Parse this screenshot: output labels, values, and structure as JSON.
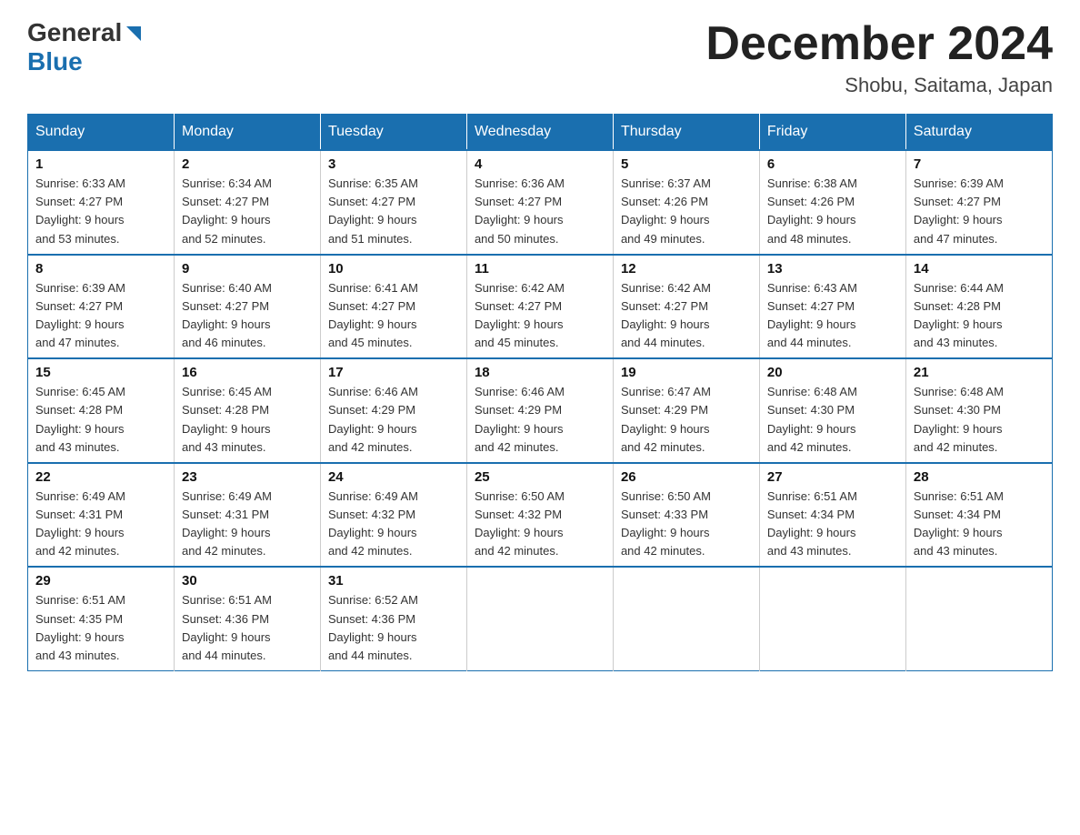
{
  "logo": {
    "general": "General",
    "blue": "Blue"
  },
  "title": {
    "month_year": "December 2024",
    "location": "Shobu, Saitama, Japan"
  },
  "days_of_week": [
    "Sunday",
    "Monday",
    "Tuesday",
    "Wednesday",
    "Thursday",
    "Friday",
    "Saturday"
  ],
  "weeks": [
    [
      {
        "day": "1",
        "sunrise": "6:33 AM",
        "sunset": "4:27 PM",
        "daylight": "9 hours and 53 minutes."
      },
      {
        "day": "2",
        "sunrise": "6:34 AM",
        "sunset": "4:27 PM",
        "daylight": "9 hours and 52 minutes."
      },
      {
        "day": "3",
        "sunrise": "6:35 AM",
        "sunset": "4:27 PM",
        "daylight": "9 hours and 51 minutes."
      },
      {
        "day": "4",
        "sunrise": "6:36 AM",
        "sunset": "4:27 PM",
        "daylight": "9 hours and 50 minutes."
      },
      {
        "day": "5",
        "sunrise": "6:37 AM",
        "sunset": "4:26 PM",
        "daylight": "9 hours and 49 minutes."
      },
      {
        "day": "6",
        "sunrise": "6:38 AM",
        "sunset": "4:26 PM",
        "daylight": "9 hours and 48 minutes."
      },
      {
        "day": "7",
        "sunrise": "6:39 AM",
        "sunset": "4:27 PM",
        "daylight": "9 hours and 47 minutes."
      }
    ],
    [
      {
        "day": "8",
        "sunrise": "6:39 AM",
        "sunset": "4:27 PM",
        "daylight": "9 hours and 47 minutes."
      },
      {
        "day": "9",
        "sunrise": "6:40 AM",
        "sunset": "4:27 PM",
        "daylight": "9 hours and 46 minutes."
      },
      {
        "day": "10",
        "sunrise": "6:41 AM",
        "sunset": "4:27 PM",
        "daylight": "9 hours and 45 minutes."
      },
      {
        "day": "11",
        "sunrise": "6:42 AM",
        "sunset": "4:27 PM",
        "daylight": "9 hours and 45 minutes."
      },
      {
        "day": "12",
        "sunrise": "6:42 AM",
        "sunset": "4:27 PM",
        "daylight": "9 hours and 44 minutes."
      },
      {
        "day": "13",
        "sunrise": "6:43 AM",
        "sunset": "4:27 PM",
        "daylight": "9 hours and 44 minutes."
      },
      {
        "day": "14",
        "sunrise": "6:44 AM",
        "sunset": "4:28 PM",
        "daylight": "9 hours and 43 minutes."
      }
    ],
    [
      {
        "day": "15",
        "sunrise": "6:45 AM",
        "sunset": "4:28 PM",
        "daylight": "9 hours and 43 minutes."
      },
      {
        "day": "16",
        "sunrise": "6:45 AM",
        "sunset": "4:28 PM",
        "daylight": "9 hours and 43 minutes."
      },
      {
        "day": "17",
        "sunrise": "6:46 AM",
        "sunset": "4:29 PM",
        "daylight": "9 hours and 42 minutes."
      },
      {
        "day": "18",
        "sunrise": "6:46 AM",
        "sunset": "4:29 PM",
        "daylight": "9 hours and 42 minutes."
      },
      {
        "day": "19",
        "sunrise": "6:47 AM",
        "sunset": "4:29 PM",
        "daylight": "9 hours and 42 minutes."
      },
      {
        "day": "20",
        "sunrise": "6:48 AM",
        "sunset": "4:30 PM",
        "daylight": "9 hours and 42 minutes."
      },
      {
        "day": "21",
        "sunrise": "6:48 AM",
        "sunset": "4:30 PM",
        "daylight": "9 hours and 42 minutes."
      }
    ],
    [
      {
        "day": "22",
        "sunrise": "6:49 AM",
        "sunset": "4:31 PM",
        "daylight": "9 hours and 42 minutes."
      },
      {
        "day": "23",
        "sunrise": "6:49 AM",
        "sunset": "4:31 PM",
        "daylight": "9 hours and 42 minutes."
      },
      {
        "day": "24",
        "sunrise": "6:49 AM",
        "sunset": "4:32 PM",
        "daylight": "9 hours and 42 minutes."
      },
      {
        "day": "25",
        "sunrise": "6:50 AM",
        "sunset": "4:32 PM",
        "daylight": "9 hours and 42 minutes."
      },
      {
        "day": "26",
        "sunrise": "6:50 AM",
        "sunset": "4:33 PM",
        "daylight": "9 hours and 42 minutes."
      },
      {
        "day": "27",
        "sunrise": "6:51 AM",
        "sunset": "4:34 PM",
        "daylight": "9 hours and 43 minutes."
      },
      {
        "day": "28",
        "sunrise": "6:51 AM",
        "sunset": "4:34 PM",
        "daylight": "9 hours and 43 minutes."
      }
    ],
    [
      {
        "day": "29",
        "sunrise": "6:51 AM",
        "sunset": "4:35 PM",
        "daylight": "9 hours and 43 minutes."
      },
      {
        "day": "30",
        "sunrise": "6:51 AM",
        "sunset": "4:36 PM",
        "daylight": "9 hours and 44 minutes."
      },
      {
        "day": "31",
        "sunrise": "6:52 AM",
        "sunset": "4:36 PM",
        "daylight": "9 hours and 44 minutes."
      },
      null,
      null,
      null,
      null
    ]
  ],
  "labels": {
    "sunrise": "Sunrise:",
    "sunset": "Sunset:",
    "daylight": "Daylight:"
  }
}
